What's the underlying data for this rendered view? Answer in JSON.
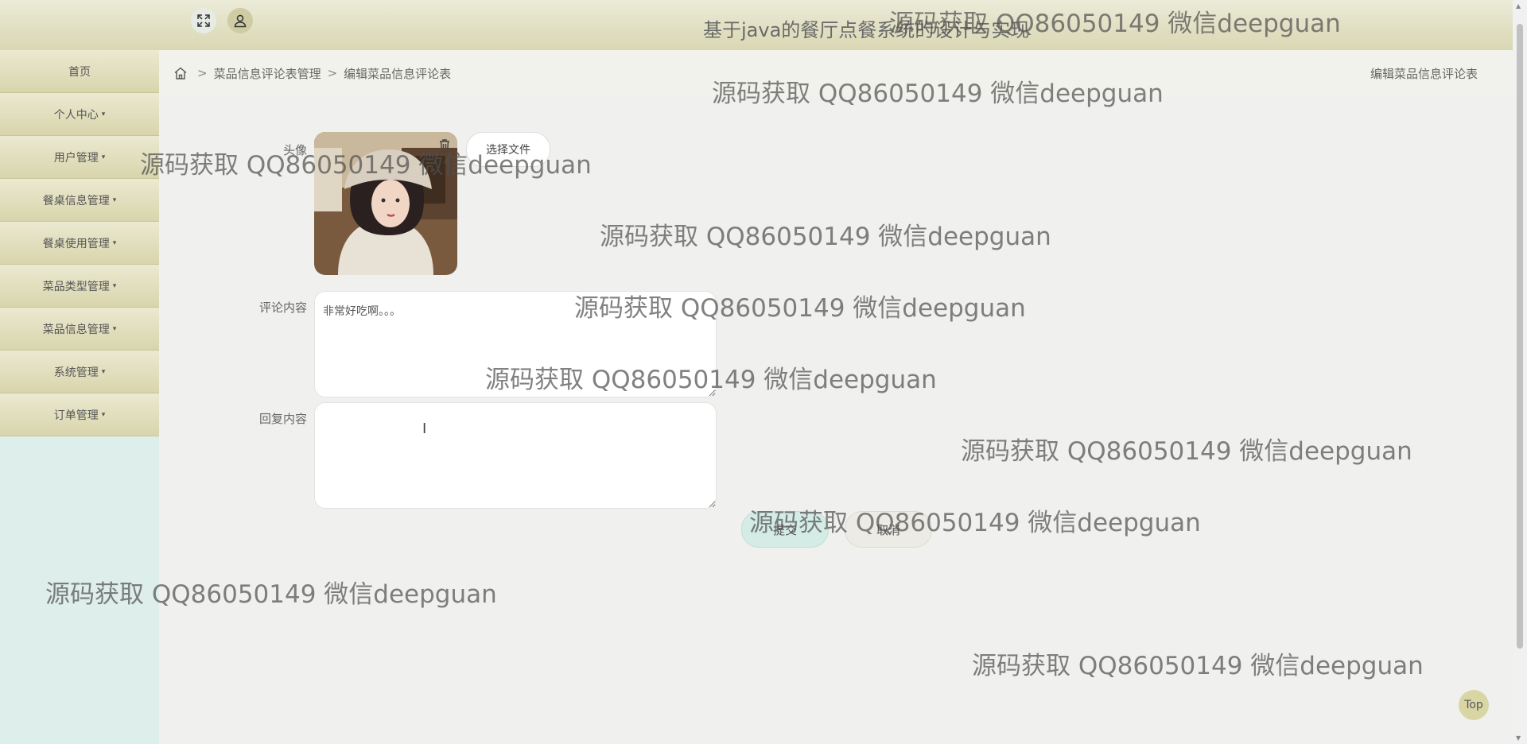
{
  "header": {
    "title": "基于java的餐厅点餐系统的设计与实现",
    "expand_icon": "fullscreen-icon",
    "user_icon": "user-icon"
  },
  "sidebar": {
    "items": [
      {
        "label": "首页",
        "has_caret": false
      },
      {
        "label": "个人中心",
        "has_caret": true
      },
      {
        "label": "用户管理",
        "has_caret": true
      },
      {
        "label": "餐桌信息管理",
        "has_caret": true
      },
      {
        "label": "餐桌使用管理",
        "has_caret": true
      },
      {
        "label": "菜品类型管理",
        "has_caret": true
      },
      {
        "label": "菜品信息管理",
        "has_caret": true
      },
      {
        "label": "系统管理",
        "has_caret": true
      },
      {
        "label": "订单管理",
        "has_caret": true
      }
    ],
    "caret": "▾"
  },
  "breadcrumb": {
    "sep": ">",
    "items": [
      "菜品信息评论表管理",
      "编辑菜品信息评论表"
    ],
    "right_title": "编辑菜品信息评论表"
  },
  "form": {
    "avatar_label": "头像",
    "choose_file": "选择文件",
    "comment_label": "评论内容",
    "comment_value": "非常好吃啊。。。",
    "reply_label": "回复内容",
    "reply_value": "",
    "submit": "提交",
    "cancel": "取消"
  },
  "watermark": "源码获取 QQ86050149 微信deepguan",
  "top_button": "Top",
  "colors": {
    "header": "#d9d7b3",
    "sidebar_bg": "#deeeea",
    "submit": "#d4ece5"
  }
}
